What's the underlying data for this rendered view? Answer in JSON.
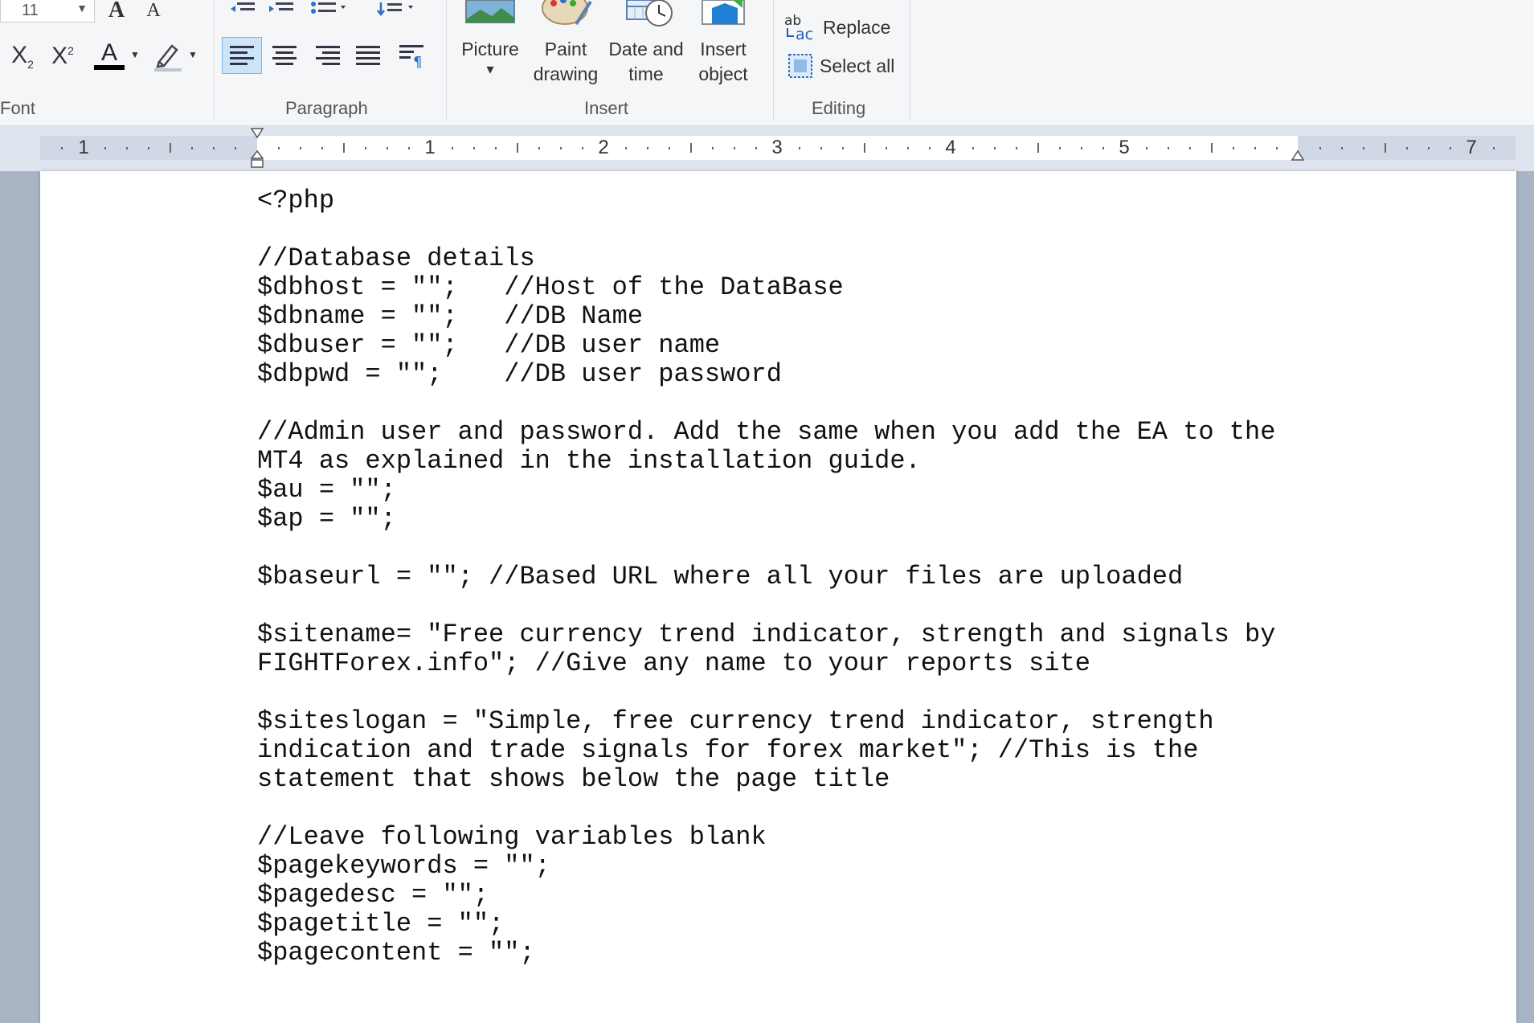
{
  "ribbon": {
    "font_group": {
      "label": "Font",
      "font_size_value": "11",
      "subscript_label": "X₂",
      "superscript_label": "X²",
      "text_color": "#000000"
    },
    "paragraph_group": {
      "label": "Paragraph"
    },
    "insert_group": {
      "label": "Insert",
      "picture": {
        "label": "Picture",
        "caret": "▾"
      },
      "paint_drawing": {
        "line1": "Paint",
        "line2": "drawing"
      },
      "date_time": {
        "line1": "Date and",
        "line2": "time"
      },
      "insert_object": {
        "line1": "Insert",
        "line2": "object"
      }
    },
    "editing_group": {
      "label": "Editing",
      "replace": "Replace",
      "select_all": "Select all"
    }
  },
  "ruler": {
    "numbers": [
      "1",
      "1",
      "2",
      "3",
      "4",
      "5",
      "7"
    ]
  },
  "document": {
    "lines": [
      "<?php",
      "",
      "//Database details",
      "$dbhost = \"\";   //Host of the DataBase",
      "$dbname = \"\";   //DB Name",
      "$dbuser = \"\";   //DB user name",
      "$dbpwd = \"\";    //DB user password",
      "",
      "//Admin user and password. Add the same when you add the EA to the",
      "MT4 as explained in the installation guide.",
      "$au = \"\";",
      "$ap = \"\";",
      "",
      "$baseurl = \"\"; //Based URL where all your files are uploaded",
      "",
      "$sitename= \"Free currency trend indicator, strength and signals by",
      "FIGHTForex.info\"; //Give any name to your reports site",
      "",
      "$siteslogan = \"Simple, free currency trend indicator, strength",
      "indication and trade signals for forex market\"; //This is the",
      "statement that shows below the page title",
      "",
      "//Leave following variables blank",
      "$pagekeywords = \"\";",
      "$pagedesc = \"\";",
      "$pagetitle = \"\";",
      "$pagecontent = \"\";"
    ]
  },
  "colors": {
    "ribbon_bg": "#f5f6f7",
    "workspace_bg": "#a9b4c4",
    "accent_selected": "#cce4f7"
  }
}
